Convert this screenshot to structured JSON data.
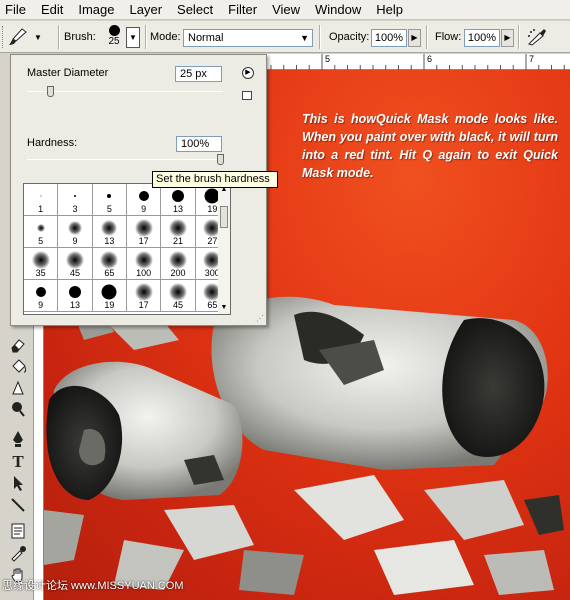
{
  "menu": [
    "File",
    "Edit",
    "Image",
    "Layer",
    "Select",
    "Filter",
    "View",
    "Window",
    "Help"
  ],
  "options_bar": {
    "brush_label": "Brush:",
    "brush_size": "25",
    "mode_label": "Mode:",
    "mode_value": "Normal",
    "opacity_label": "Opacity:",
    "opacity_value": "100%",
    "flow_label": "Flow:",
    "flow_value": "100%"
  },
  "ruler": {
    "ticks": [
      "5",
      "6",
      "7"
    ]
  },
  "brush_panel": {
    "master_diameter_label": "Master Diameter",
    "master_diameter_value": "25 px",
    "hardness_label": "Hardness:",
    "hardness_value": "100%",
    "tooltip": "Set the brush hardness",
    "presets": [
      {
        "size": "1",
        "kind": "hard"
      },
      {
        "size": "3",
        "kind": "hard"
      },
      {
        "size": "5",
        "kind": "hard"
      },
      {
        "size": "9",
        "kind": "hard"
      },
      {
        "size": "13",
        "kind": "hard"
      },
      {
        "size": "19",
        "kind": "hard"
      },
      {
        "size": "5",
        "kind": "soft"
      },
      {
        "size": "9",
        "kind": "soft"
      },
      {
        "size": "13",
        "kind": "soft"
      },
      {
        "size": "17",
        "kind": "soft"
      },
      {
        "size": "21",
        "kind": "soft"
      },
      {
        "size": "27",
        "kind": "soft"
      },
      {
        "size": "35",
        "kind": "soft"
      },
      {
        "size": "45",
        "kind": "soft"
      },
      {
        "size": "65",
        "kind": "soft"
      },
      {
        "size": "100",
        "kind": "soft"
      },
      {
        "size": "200",
        "kind": "soft"
      },
      {
        "size": "300",
        "kind": "soft"
      },
      {
        "size": "9",
        "kind": "hard"
      },
      {
        "size": "13",
        "kind": "hard"
      },
      {
        "size": "19",
        "kind": "hard"
      },
      {
        "size": "17",
        "kind": "soft"
      },
      {
        "size": "45",
        "kind": "soft"
      },
      {
        "size": "65",
        "kind": "soft"
      }
    ]
  },
  "canvas": {
    "caption": "This is howQuick Mask mode looks like. When you paint over with black, it will turn into a red tint. Hit Q again to exit Quick Mask mode."
  },
  "watermark": "思缘设计论坛 www.MISSYUAN.COM",
  "tools": [
    "eraser-icon",
    "paint-bucket-icon",
    "blur-icon",
    "dodge-icon",
    "pen-icon",
    "type-icon",
    "path-selection-icon",
    "line-icon",
    "notes-icon",
    "eyedropper-icon",
    "hand-icon"
  ]
}
